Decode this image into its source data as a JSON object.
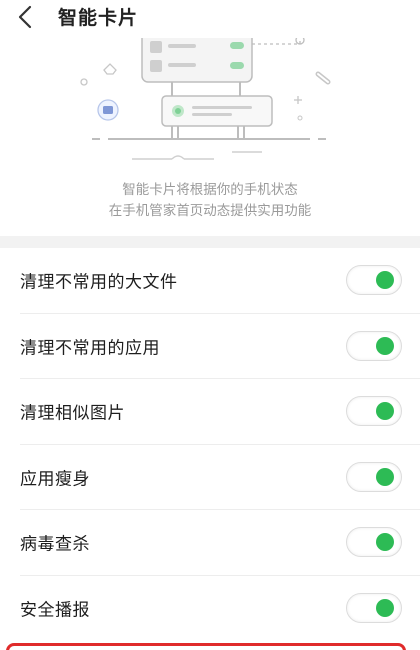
{
  "header": {
    "title": "智能卡片",
    "back_icon": "chevron-left-icon"
  },
  "illustration": {
    "icon": "phone-manager-cards-illustration"
  },
  "description": {
    "line1": "智能卡片将根据你的手机状态",
    "line2": "在手机管家首页动态提供实用功能"
  },
  "settings": [
    {
      "label": "清理不常用的大文件",
      "enabled": true
    },
    {
      "label": "清理不常用的应用",
      "enabled": true
    },
    {
      "label": "清理相似图片",
      "enabled": true
    },
    {
      "label": "应用瘦身",
      "enabled": true
    },
    {
      "label": "病毒查杀",
      "enabled": true
    },
    {
      "label": "安全播报",
      "enabled": true
    }
  ],
  "colors": {
    "toggle_on": "#2dbb55",
    "highlight": "#e02b2b"
  }
}
